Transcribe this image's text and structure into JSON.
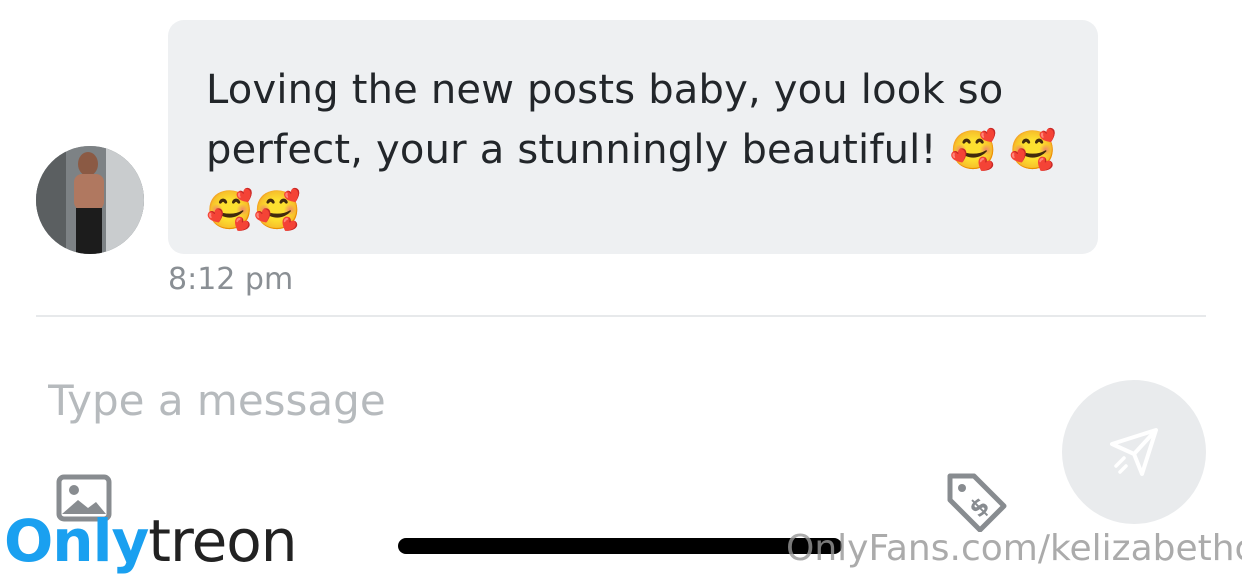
{
  "message": {
    "text": "Loving the new posts baby, you look so perfect, your a stunningly beautiful!",
    "emojis": "🥰 🥰🥰🥰",
    "time": "8:12 pm"
  },
  "composer": {
    "placeholder": "Type a message",
    "send_icon": "send-icon",
    "media_icon": "image-icon",
    "price_icon": "price-tag-icon"
  },
  "watermark": {
    "logo_part1": "Only",
    "logo_part2": "treon",
    "url": "OnlyFans.com/kelizabethc"
  },
  "colors": {
    "bubble": "#eef0f2",
    "accent": "#1aa0f0",
    "placeholder": "#b6babd"
  }
}
